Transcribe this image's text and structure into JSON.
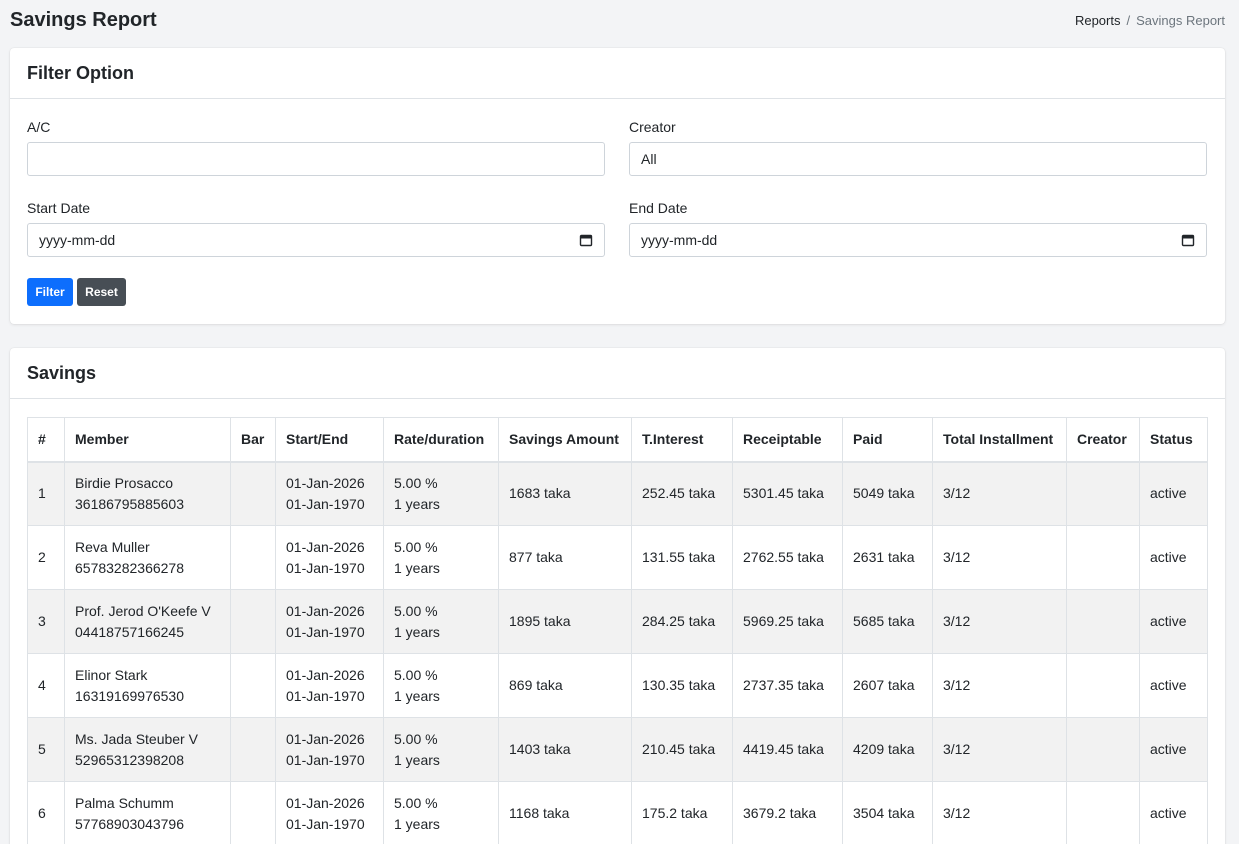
{
  "header": {
    "title": "Savings Report",
    "breadcrumb": {
      "parent": "Reports",
      "separator": "/",
      "current": "Savings Report"
    }
  },
  "filter": {
    "title": "Filter Option",
    "ac_label": "A/C",
    "ac_value": "",
    "creator_label": "Creator",
    "creator_value": "All",
    "start_label": "Start Date",
    "start_value": "yyyy-mm-dd",
    "end_label": "End Date",
    "end_value": "yyyy-mm-dd",
    "filter_button": "Filter",
    "reset_button": "Reset"
  },
  "savings": {
    "title": "Savings",
    "columns": [
      "#",
      "Member",
      "Bar",
      "Start/End",
      "Rate/duration",
      "Savings Amount",
      "T.Interest",
      "Receiptable",
      "Paid",
      "Total Installment",
      "Creator",
      "Status"
    ],
    "rows": [
      {
        "num": "1",
        "name": "Birdie Prosacco",
        "acc": "36186795885603",
        "bar": "",
        "start": "01-Jan-2026",
        "end": "01-Jan-1970",
        "rate": "5.00 %",
        "duration": "1 years",
        "amount": "1683 taka",
        "interest": "252.45 taka",
        "receiptable": "5301.45 taka",
        "paid": "5049 taka",
        "installment": "3/12",
        "creator": "",
        "status": "active"
      },
      {
        "num": "2",
        "name": "Reva Muller",
        "acc": "65783282366278",
        "bar": "",
        "start": "01-Jan-2026",
        "end": "01-Jan-1970",
        "rate": "5.00 %",
        "duration": "1 years",
        "amount": "877 taka",
        "interest": "131.55 taka",
        "receiptable": "2762.55 taka",
        "paid": "2631 taka",
        "installment": "3/12",
        "creator": "",
        "status": "active"
      },
      {
        "num": "3",
        "name": "Prof. Jerod O'Keefe V",
        "acc": "04418757166245",
        "bar": "",
        "start": "01-Jan-2026",
        "end": "01-Jan-1970",
        "rate": "5.00 %",
        "duration": "1 years",
        "amount": "1895 taka",
        "interest": "284.25 taka",
        "receiptable": "5969.25 taka",
        "paid": "5685 taka",
        "installment": "3/12",
        "creator": "",
        "status": "active"
      },
      {
        "num": "4",
        "name": "Elinor Stark",
        "acc": "16319169976530",
        "bar": "",
        "start": "01-Jan-2026",
        "end": "01-Jan-1970",
        "rate": "5.00 %",
        "duration": "1 years",
        "amount": "869 taka",
        "interest": "130.35 taka",
        "receiptable": "2737.35 taka",
        "paid": "2607 taka",
        "installment": "3/12",
        "creator": "",
        "status": "active"
      },
      {
        "num": "5",
        "name": "Ms. Jada Steuber V",
        "acc": "52965312398208",
        "bar": "",
        "start": "01-Jan-2026",
        "end": "01-Jan-1970",
        "rate": "5.00 %",
        "duration": "1 years",
        "amount": "1403 taka",
        "interest": "210.45 taka",
        "receiptable": "4419.45 taka",
        "paid": "4209 taka",
        "installment": "3/12",
        "creator": "",
        "status": "active"
      },
      {
        "num": "6",
        "name": "Palma Schumm",
        "acc": "57768903043796",
        "bar": "",
        "start": "01-Jan-2026",
        "end": "01-Jan-1970",
        "rate": "5.00 %",
        "duration": "1 years",
        "amount": "1168 taka",
        "interest": "175.2 taka",
        "receiptable": "3679.2 taka",
        "paid": "3504 taka",
        "installment": "3/12",
        "creator": "",
        "status": "active"
      }
    ]
  },
  "colors": {
    "primary": "#0d6efd",
    "secondary": "#474e55",
    "background": "#f3f4f6",
    "stripe": "#f2f2f2"
  },
  "icons": {
    "date_picker": "calendar-icon"
  }
}
